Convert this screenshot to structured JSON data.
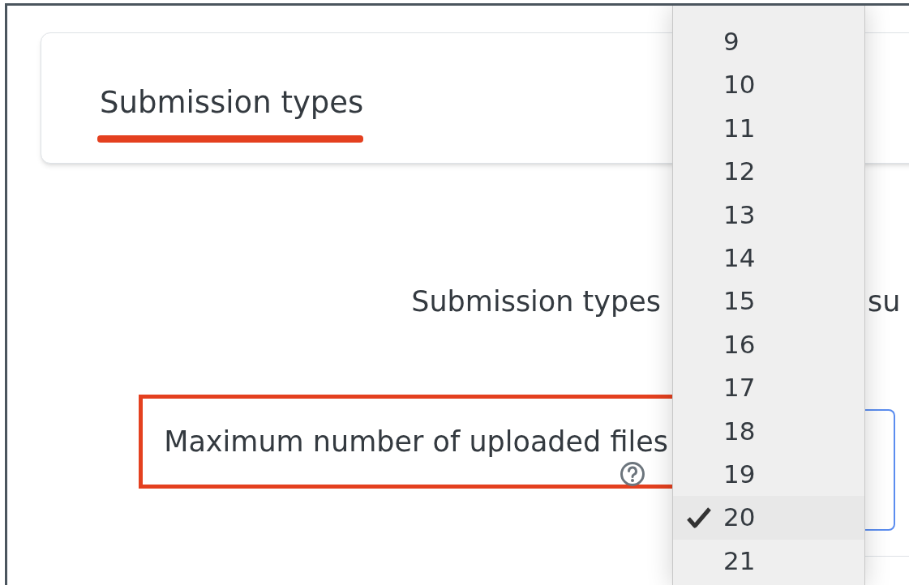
{
  "section": {
    "title": "Submission types",
    "underlined": true
  },
  "fields": [
    {
      "label": "Submission types",
      "boxed": false,
      "help": false,
      "value_fragment": "su"
    },
    {
      "label": "Maximum number of uploaded files",
      "boxed": true,
      "help": true
    }
  ],
  "dropdown": {
    "options": [
      {
        "label": "9",
        "selected": false
      },
      {
        "label": "10",
        "selected": false
      },
      {
        "label": "11",
        "selected": false
      },
      {
        "label": "12",
        "selected": false
      },
      {
        "label": "13",
        "selected": false
      },
      {
        "label": "14",
        "selected": false
      },
      {
        "label": "15",
        "selected": false
      },
      {
        "label": "16",
        "selected": false
      },
      {
        "label": "17",
        "selected": false
      },
      {
        "label": "18",
        "selected": false
      },
      {
        "label": "19",
        "selected": false
      },
      {
        "label": "20",
        "selected": true
      },
      {
        "label": "21",
        "selected": false
      }
    ]
  }
}
